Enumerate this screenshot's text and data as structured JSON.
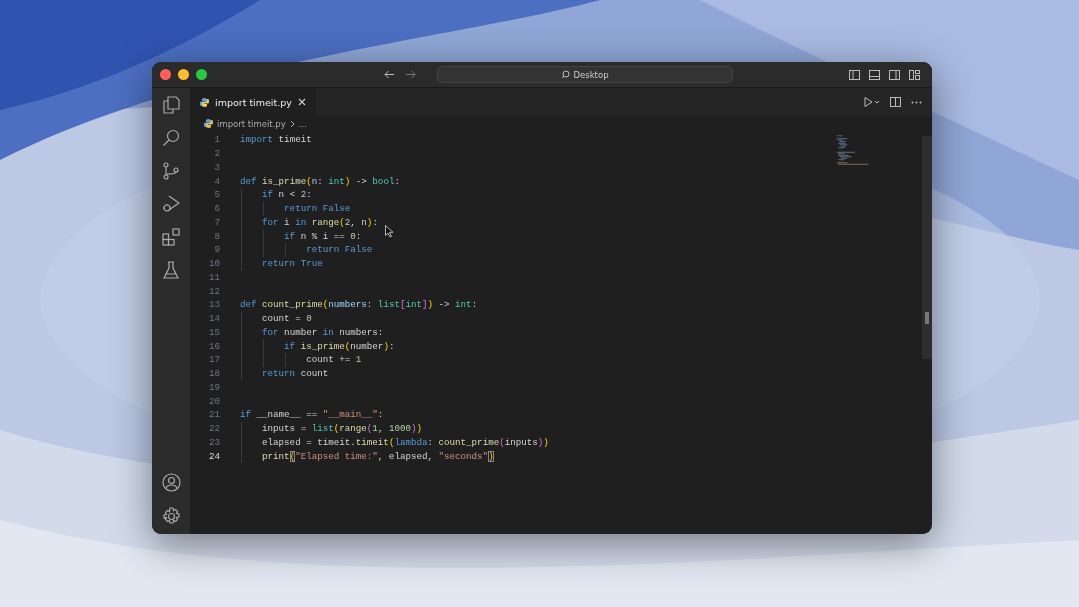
{
  "window": {
    "search": "Desktop"
  },
  "tabs": [
    {
      "label": "import timeit.py",
      "selected": true
    }
  ],
  "breadcrumb": {
    "file": "import timeit.py",
    "rest": "..."
  },
  "lines": [
    {
      "number": "1",
      "current": false,
      "tokens": [
        {
          "kind": "keyword",
          "text": "import"
        },
        {
          "kind": "plain",
          "text": " timeit"
        }
      ]
    },
    {
      "number": "2",
      "current": false
    },
    {
      "number": "3",
      "current": false
    },
    {
      "number": "4",
      "current": false,
      "tokens": [
        {
          "kind": "keyword",
          "text": "def"
        },
        {
          "kind": "function",
          "text": " is_prime"
        },
        {
          "kind": "bracket",
          "text": "("
        },
        {
          "kind": "param",
          "text": "n"
        },
        {
          "kind": "plain",
          "text": ":"
        },
        {
          "kind": "type",
          "text": " int"
        },
        {
          "kind": "bracket",
          "text": ")"
        },
        {
          "kind": "plain",
          "text": " ->"
        },
        {
          "kind": "type",
          "text": " bool"
        },
        {
          "kind": "plain",
          "text": ":"
        }
      ]
    },
    {
      "number": "5",
      "current": false,
      "tokens": [
        {
          "kind": "keyword",
          "text": "    if"
        },
        {
          "kind": "plain",
          "text": " n <"
        },
        {
          "kind": "number",
          "text": " 2"
        },
        {
          "kind": "plain",
          "text": ":"
        }
      ]
    },
    {
      "number": "6",
      "current": false,
      "tokens": [
        {
          "kind": "keyword",
          "text": "        return False"
        }
      ]
    },
    {
      "number": "7",
      "current": false,
      "tokens": [
        {
          "kind": "keyword",
          "text": "    for"
        },
        {
          "kind": "plain",
          "text": " i"
        },
        {
          "kind": "keyword",
          "text": " in"
        },
        {
          "kind": "function",
          "text": " range"
        },
        {
          "kind": "bracket",
          "text": "("
        },
        {
          "kind": "number",
          "text": "2"
        },
        {
          "kind": "plain",
          "text": ", n"
        },
        {
          "kind": "bracket",
          "text": ")"
        },
        {
          "kind": "plain",
          "text": ":"
        }
      ]
    },
    {
      "number": "8",
      "current": false,
      "tokens": [
        {
          "kind": "keyword",
          "text": "        if"
        },
        {
          "kind": "plain",
          "text": " n % i =="
        },
        {
          "kind": "number",
          "text": " 0"
        },
        {
          "kind": "plain",
          "text": ":"
        }
      ]
    },
    {
      "number": "9",
      "current": false,
      "tokens": [
        {
          "kind": "keyword",
          "text": "            return False"
        }
      ]
    },
    {
      "number": "10",
      "current": false,
      "tokens": [
        {
          "kind": "keyword",
          "text": "    return True"
        }
      ]
    },
    {
      "number": "11",
      "current": false
    },
    {
      "number": "12",
      "current": false
    },
    {
      "number": "13",
      "current": false,
      "tokens": [
        {
          "kind": "keyword",
          "text": "def"
        },
        {
          "kind": "function",
          "text": " count_prime"
        },
        {
          "kind": "bracket",
          "text": "("
        },
        {
          "kind": "param",
          "text": "numbers"
        },
        {
          "kind": "plain",
          "text": ":"
        },
        {
          "kind": "type",
          "text": " list"
        },
        {
          "kind": "bracket2",
          "text": "["
        },
        {
          "kind": "type",
          "text": "int"
        },
        {
          "kind": "bracket2",
          "text": "]"
        },
        {
          "kind": "bracket",
          "text": ")"
        },
        {
          "kind": "plain",
          "text": " ->"
        },
        {
          "kind": "type",
          "text": " int"
        },
        {
          "kind": "plain",
          "text": ":"
        }
      ]
    },
    {
      "number": "14",
      "current": false,
      "tokens": [
        {
          "kind": "plain",
          "text": "    count ="
        },
        {
          "kind": "number",
          "text": " 0"
        }
      ]
    },
    {
      "number": "15",
      "current": false,
      "tokens": [
        {
          "kind": "keyword",
          "text": "    for"
        },
        {
          "kind": "plain",
          "text": " number"
        },
        {
          "kind": "keyword",
          "text": " in"
        },
        {
          "kind": "plain",
          "text": " numbers:"
        }
      ]
    },
    {
      "number": "16",
      "current": false,
      "tokens": [
        {
          "kind": "keyword",
          "text": "        if"
        },
        {
          "kind": "function",
          "text": " is_prime"
        },
        {
          "kind": "bracket",
          "text": "("
        },
        {
          "kind": "plain",
          "text": "number"
        },
        {
          "kind": "bracket",
          "text": ")"
        },
        {
          "kind": "plain",
          "text": ":"
        }
      ]
    },
    {
      "number": "17",
      "current": false,
      "tokens": [
        {
          "kind": "plain",
          "text": "            count +="
        },
        {
          "kind": "number",
          "text": " 1"
        }
      ]
    },
    {
      "number": "18",
      "current": false,
      "tokens": [
        {
          "kind": "keyword",
          "text": "    return"
        },
        {
          "kind": "plain",
          "text": " count"
        }
      ]
    },
    {
      "number": "19",
      "current": false
    },
    {
      "number": "20",
      "current": false
    },
    {
      "number": "21",
      "current": false,
      "tokens": [
        {
          "kind": "keyword",
          "text": "if"
        },
        {
          "kind": "plain",
          "text": " __name__ =="
        },
        {
          "kind": "string",
          "text": " \"__main__\""
        },
        {
          "kind": "plain",
          "text": ":"
        }
      ]
    },
    {
      "number": "22",
      "current": false,
      "tokens": [
        {
          "kind": "plain",
          "text": "    inputs ="
        },
        {
          "kind": "type",
          "text": " list"
        },
        {
          "kind": "bracket",
          "text": "("
        },
        {
          "kind": "function",
          "text": "range"
        },
        {
          "kind": "bracket2",
          "text": "("
        },
        {
          "kind": "number",
          "text": "1"
        },
        {
          "kind": "plain",
          "text": ","
        },
        {
          "kind": "number",
          "text": " 1000"
        },
        {
          "kind": "bracket2",
          "text": ")"
        },
        {
          "kind": "bracket",
          "text": ")"
        }
      ]
    },
    {
      "number": "23",
      "current": false,
      "tokens": [
        {
          "kind": "plain",
          "text": "    elapsed = timeit."
        },
        {
          "kind": "function",
          "text": "timeit"
        },
        {
          "kind": "bracket",
          "text": "("
        },
        {
          "kind": "keyword",
          "text": "lambda"
        },
        {
          "kind": "plain",
          "text": ":"
        },
        {
          "kind": "function",
          "text": " count_prime"
        },
        {
          "kind": "bracket2",
          "text": "("
        },
        {
          "kind": "plain",
          "text": "inputs"
        },
        {
          "kind": "bracket2",
          "text": ")"
        },
        {
          "kind": "bracket",
          "text": ")"
        }
      ]
    },
    {
      "number": "24",
      "current": true,
      "tokens": [
        {
          "kind": "function",
          "text": "    print"
        },
        {
          "kind": "match",
          "text": "("
        },
        {
          "kind": "string",
          "text": "\"Elapsed time:\""
        },
        {
          "kind": "plain",
          "text": ", elapsed,"
        },
        {
          "kind": "string",
          "text": " \"seconds\""
        },
        {
          "kind": "match",
          "text": ")"
        }
      ]
    }
  ]
}
